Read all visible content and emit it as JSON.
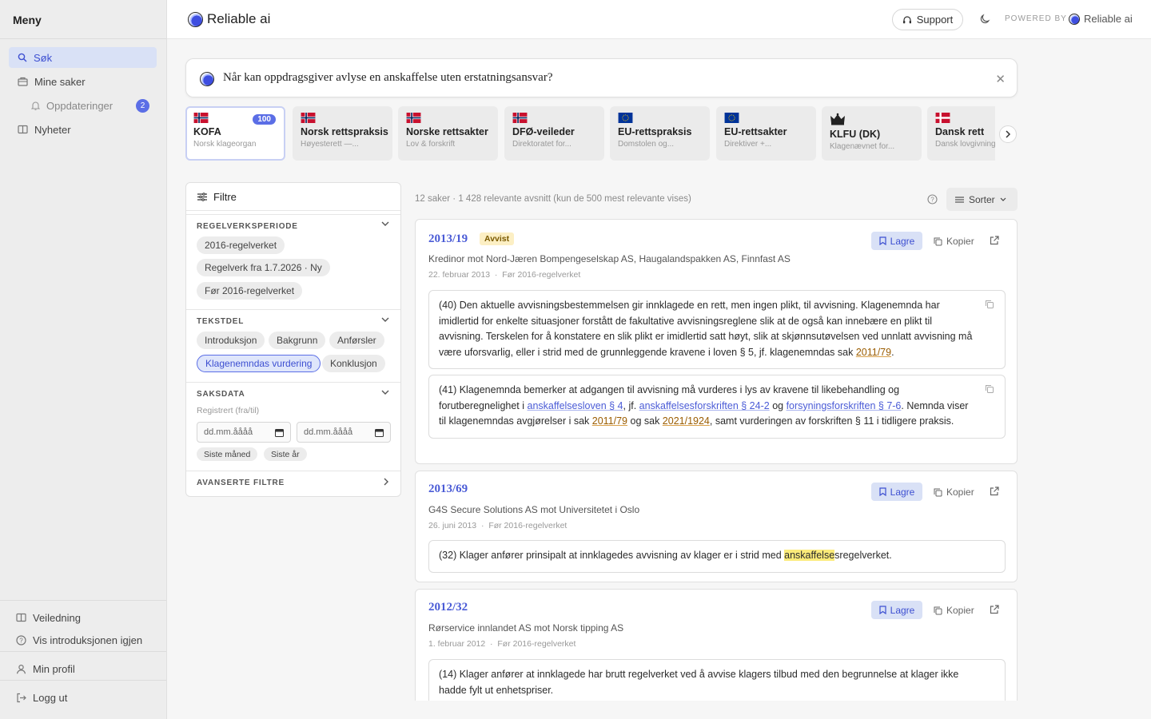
{
  "sidebar": {
    "title": "Meny",
    "items": [
      {
        "label": "Søk",
        "icon": "search-icon"
      },
      {
        "label": "Mine saker",
        "icon": "folder-icon"
      },
      {
        "label": "Oppdateringer",
        "icon": "bell-icon",
        "count": "2"
      },
      {
        "label": "Nyheter",
        "icon": "book-icon"
      }
    ],
    "bottom": [
      {
        "label": "Veiledning",
        "icon": "book-icon"
      },
      {
        "label": "Vis introduksjonen igjen",
        "icon": "help-circle-icon"
      },
      {
        "label": "Min profil",
        "icon": "user-icon"
      },
      {
        "label": "Logg ut",
        "icon": "logout-icon"
      }
    ]
  },
  "header": {
    "brand": "Reliable ai",
    "support_label": "Support",
    "powered_by": "POWERED BY",
    "powered_brand": "Reliable ai"
  },
  "search": {
    "query": "Når kan oppdragsgiver avlyse en anskaffelse uten erstatningsansvar?"
  },
  "sources": [
    {
      "name": "KOFA",
      "sub": "Norsk klageorgan",
      "flag": "no",
      "count": "100",
      "active": true
    },
    {
      "name": "Norsk rettspraksis",
      "sub": "Høyesterett —...",
      "flag": "no"
    },
    {
      "name": "Norske rettsakter",
      "sub": "Lov & forskrift",
      "flag": "no"
    },
    {
      "name": "DFØ-veileder",
      "sub": "Direktoratet for...",
      "flag": "no"
    },
    {
      "name": "EU-rettspraksis",
      "sub": "Domstolen og...",
      "flag": "eu"
    },
    {
      "name": "EU-rettsakter",
      "sub": "Direktiver +...",
      "flag": "eu"
    },
    {
      "name": "KLFU (DK)",
      "sub": "Klagenævnet for...",
      "flag": "crown"
    },
    {
      "name": "Dansk rett",
      "sub": "Dansk lovgivning",
      "flag": "dk"
    }
  ],
  "filters": {
    "title": "Filtre",
    "period": {
      "label": "REGELVERKSPERIODE",
      "options": [
        "2016-regelverket",
        "Regelverk fra 1.7.2026 · Ny",
        "Før 2016-regelverket"
      ]
    },
    "textpart": {
      "label": "TEKSTDEL",
      "options": [
        "Introduksjon",
        "Bakgrunn",
        "Anførsler",
        "Klagenemndas vurdering",
        "Konklusjon"
      ],
      "selected": "Klagenemndas vurdering"
    },
    "casedata": {
      "label": "SAKSDATA",
      "registered_label": "Registrert (fra/til)",
      "date_placeholder": "dd.mm.åååå",
      "quick": [
        "Siste måned",
        "Siste år"
      ]
    },
    "advanced": {
      "label": "AVANSERTE FILTRE"
    }
  },
  "results": {
    "summary": "12 saker · 1 428 relevante avsnitt (kun de 500 mest relevante vises)",
    "sort_label": "Sorter",
    "save_label": "Lagre",
    "copy_label": "Kopier",
    "cases": [
      {
        "id": "2013/19",
        "status": "Avvist",
        "parties": "Kredinor mot Nord-Jæren Bompengeselskap AS, Haugalandspakken AS, Finnfast AS",
        "date": "22. februar 2013",
        "period": "Før 2016-regelverket",
        "excerpts": [
          {
            "text1": "(40) Den aktuelle avvisningsbestemmelsen gir innklagede en rett, men ingen plikt, til avvisning. Klagenemnda har imidlertid for enkelte situasjoner forstått de fakultative avvisningsreglene slik at de også kan innebære en plikt til avvisning. Terskelen for å konstatere en slik plikt er imidlertid satt høyt, slik at skjønnsutøvelsen ved unnlatt avvisning må være uforsvarlig, eller i strid med de grunnleggende kravene i loven § 5, jf. klagenemndas sak ",
            "ref1": "2011/79",
            "text2": "."
          },
          {
            "t1": "(41) Klagenemnda bemerker at adgangen til avvisning må vurderes i lys av kravene til likebehandling og forutberegnelighet i ",
            "l1": "anskaffelsesloven § 4",
            "t2": ", jf. ",
            "l2": "anskaffelsesforskriften § 24-2",
            "t3": " og ",
            "l3": "forsyningsforskriften § 7-6",
            "t4": ". Nemnda viser til klagenemndas avgjørelser i sak ",
            "r1": "2011/79",
            "t5": " og sak ",
            "r2": "2021/1924",
            "t6": ", samt vurderingen av forskriften § 11 i tidligere praksis."
          }
        ]
      },
      {
        "id": "2013/69",
        "parties": "G4S Secure Solutions AS mot Universitetet i Oslo",
        "date": "26. juni 2013",
        "period": "Før 2016-regelverket",
        "excerpt": {
          "t1": "(32) Klager anfører prinsipalt at innklagedes avvisning av klager er i strid med ",
          "hl": "anskaffelse",
          "t2": "sregelverket."
        }
      },
      {
        "id": "2012/32",
        "parties": "Rørservice innlandet AS mot Norsk tipping AS",
        "date": "1. februar 2012",
        "period": "Før 2016-regelverket",
        "excerpt": {
          "t1": "(14) Klager anfører at innklagede har brutt regelverket ved å avvise klagers tilbud med den begrunnelse at klager ikke hadde fylt ut enhetspriser."
        }
      }
    ]
  },
  "colors": {
    "accent": "#5b6ee6",
    "active_bg": "#d9e1f6",
    "highlight": "#fbeb7a"
  }
}
